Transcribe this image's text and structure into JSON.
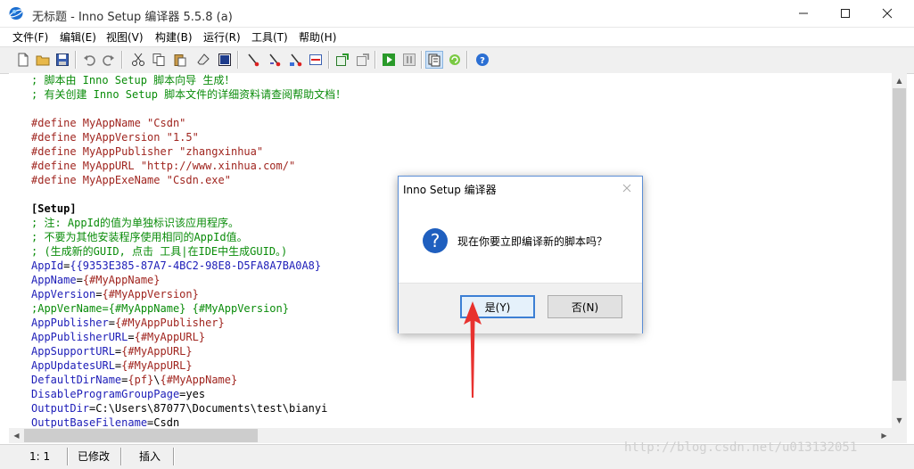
{
  "window": {
    "title": "无标题 - Inno Setup 编译器 5.5.8 (a)"
  },
  "menu": [
    "文件(F)",
    "编辑(E)",
    "视图(V)",
    "构建(B)",
    "运行(R)",
    "工具(T)",
    "帮助(H)"
  ],
  "toolbar": {
    "icons": [
      "new-file-icon",
      "open-folder-icon",
      "save-icon",
      "undo-icon",
      "redo-icon",
      "cut-icon",
      "copy-icon",
      "paste-icon",
      "eraser-icon",
      "select-all-icon",
      "find-icon",
      "find-next-icon",
      "replace-icon",
      "goto-icon",
      "compile-icon",
      "stop-compile-icon",
      "run-icon",
      "pause-icon",
      "target-icon",
      "help-icon"
    ]
  },
  "editor": {
    "lines": [
      {
        "segs": [
          {
            "c": "cmt",
            "t": "; 脚本由 Inno Setup 脚本向导 生成！"
          }
        ]
      },
      {
        "segs": [
          {
            "c": "cmt",
            "t": "; 有关创建 Inno Setup 脚本文件的详细资料请查阅帮助文档！"
          }
        ]
      },
      {
        "segs": []
      },
      {
        "segs": [
          {
            "c": "def",
            "t": "#define MyAppName \"Csdn\""
          }
        ]
      },
      {
        "segs": [
          {
            "c": "def",
            "t": "#define MyAppVersion \"1.5\""
          }
        ]
      },
      {
        "segs": [
          {
            "c": "def",
            "t": "#define MyAppPublisher \"zhangxinhua\""
          }
        ]
      },
      {
        "segs": [
          {
            "c": "def",
            "t": "#define MyAppURL \"http://www.xinhua.com/\""
          }
        ]
      },
      {
        "segs": [
          {
            "c": "def",
            "t": "#define MyAppExeName \"Csdn.exe\""
          }
        ]
      },
      {
        "segs": []
      },
      {
        "segs": [
          {
            "c": "sec",
            "t": "[Setup]"
          }
        ]
      },
      {
        "segs": [
          {
            "c": "cmt",
            "t": "; 注: AppId的值为单独标识该应用程序。"
          }
        ]
      },
      {
        "segs": [
          {
            "c": "cmt",
            "t": "; 不要为其他安装程序使用相同的AppId值。"
          }
        ]
      },
      {
        "segs": [
          {
            "c": "cmt",
            "t": "; (生成新的GUID, 点击 工具|在IDE中生成GUID。)"
          }
        ]
      },
      {
        "segs": [
          {
            "c": "key",
            "t": "AppId"
          },
          {
            "c": "plain",
            "t": "="
          },
          {
            "c": "key",
            "t": "{{9353E385-87A7-4BC2-98E8-D5FA8A7BA0A8}"
          }
        ]
      },
      {
        "segs": [
          {
            "c": "key",
            "t": "AppName"
          },
          {
            "c": "plain",
            "t": "="
          },
          {
            "c": "val",
            "t": "{#MyAppName}"
          }
        ]
      },
      {
        "segs": [
          {
            "c": "key",
            "t": "AppVersion"
          },
          {
            "c": "plain",
            "t": "="
          },
          {
            "c": "val",
            "t": "{#MyAppVersion}"
          }
        ]
      },
      {
        "segs": [
          {
            "c": "cmt",
            "t": ";AppVerName={#MyAppName} {#MyAppVersion}"
          }
        ]
      },
      {
        "segs": [
          {
            "c": "key",
            "t": "AppPublisher"
          },
          {
            "c": "plain",
            "t": "="
          },
          {
            "c": "val",
            "t": "{#MyAppPublisher}"
          }
        ]
      },
      {
        "segs": [
          {
            "c": "key",
            "t": "AppPublisherURL"
          },
          {
            "c": "plain",
            "t": "="
          },
          {
            "c": "val",
            "t": "{#MyAppURL}"
          }
        ]
      },
      {
        "segs": [
          {
            "c": "key",
            "t": "AppSupportURL"
          },
          {
            "c": "plain",
            "t": "="
          },
          {
            "c": "val",
            "t": "{#MyAppURL}"
          }
        ]
      },
      {
        "segs": [
          {
            "c": "key",
            "t": "AppUpdatesURL"
          },
          {
            "c": "plain",
            "t": "="
          },
          {
            "c": "val",
            "t": "{#MyAppURL}"
          }
        ]
      },
      {
        "segs": [
          {
            "c": "key",
            "t": "DefaultDirName"
          },
          {
            "c": "plain",
            "t": "="
          },
          {
            "c": "val",
            "t": "{pf}"
          },
          {
            "c": "plain",
            "t": "\\"
          },
          {
            "c": "val",
            "t": "{#MyAppName}"
          }
        ]
      },
      {
        "segs": [
          {
            "c": "key",
            "t": "DisableProgramGroupPage"
          },
          {
            "c": "plain",
            "t": "=yes"
          }
        ]
      },
      {
        "segs": [
          {
            "c": "key",
            "t": "OutputDir"
          },
          {
            "c": "plain",
            "t": "=C:\\Users\\87077\\Documents\\test\\bianyi"
          }
        ]
      },
      {
        "segs": [
          {
            "c": "key",
            "t": "OutputBaseFilename"
          },
          {
            "c": "plain",
            "t": "=Csdn"
          }
        ]
      }
    ]
  },
  "status": {
    "position": "1:   1",
    "modified": "已修改",
    "mode": "插入"
  },
  "watermark": "http://blog.csdn.net/u013132051",
  "dialog": {
    "title": "Inno Setup 编译器",
    "message": "现在你要立即编译新的脚本吗？",
    "yes_label": "是(Y)",
    "no_label": "否(N)"
  },
  "colors": {
    "comment": "#0a8c0a",
    "define": "#a0251f",
    "keyword": "#1d1db8",
    "annotation_arrow": "#e8322f",
    "dialog_border": "#5b8ed6"
  }
}
